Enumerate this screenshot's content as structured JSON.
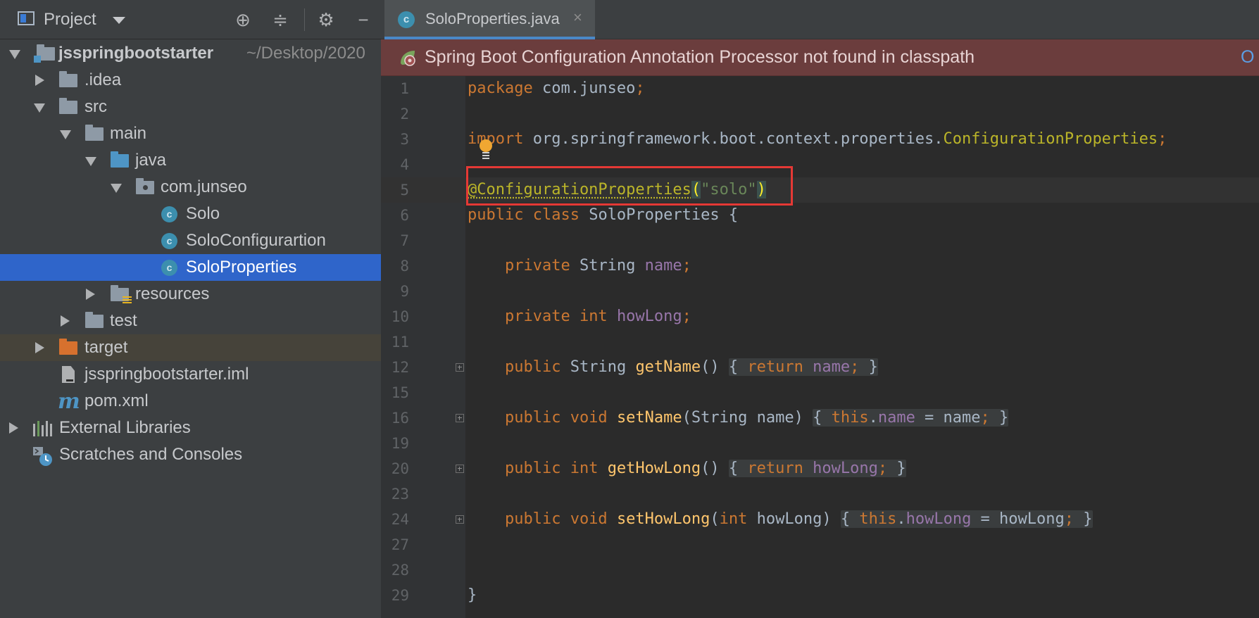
{
  "project_panel": {
    "title": "Project",
    "tree": [
      {
        "label": "jsspringbootstarter",
        "hint": "~/Desktop/2020"
      },
      {
        "label": ".idea"
      },
      {
        "label": "src"
      },
      {
        "label": "main"
      },
      {
        "label": "java"
      },
      {
        "label": "com.junseo"
      },
      {
        "label": "Solo"
      },
      {
        "label": "SoloConfigurartion"
      },
      {
        "label": "SoloProperties"
      },
      {
        "label": "resources"
      },
      {
        "label": "test"
      },
      {
        "label": "target"
      },
      {
        "label": "jsspringbootstarter.iml"
      },
      {
        "label": "pom.xml"
      },
      {
        "label": "External Libraries"
      },
      {
        "label": "Scratches and Consoles"
      }
    ],
    "class_icon_letter": "c",
    "maven_icon_letter": "m"
  },
  "editor": {
    "tab_label": "SoloProperties.java",
    "tab_close": "×",
    "tab_icon_letter": "c",
    "notification": {
      "text": "Spring Boot Configuration Annotation Processor not found in classpath",
      "link": "O"
    },
    "line_numbers": [
      "1",
      "2",
      "3",
      "4",
      "5",
      "6",
      "7",
      "8",
      "9",
      "10",
      "11",
      "12",
      "15",
      "16",
      "19",
      "20",
      "23",
      "24",
      "27",
      "28",
      "29"
    ],
    "code": {
      "l1": {
        "kw": "package",
        "rest": " com.junseo",
        "semi": ";"
      },
      "l3": {
        "kw": "import",
        "rest": " org.springframework.boot.context.properties.",
        "cls": "ConfigurationProperties",
        "semi": ";"
      },
      "l5": {
        "ann": "@ConfigurationProperties",
        "open": "(",
        "str": "\"solo\"",
        "close": ")"
      },
      "l6": {
        "kw": "public class",
        "rest": " SoloProperties {"
      },
      "l8": {
        "indent": "    ",
        "kw": "private",
        "ty": " String ",
        "fld": "name",
        "semi": ";"
      },
      "l10": {
        "indent": "    ",
        "kw": "private int",
        "ty": " ",
        "fld": "howLong",
        "semi": ";"
      },
      "l12": {
        "indent": "    ",
        "kw": "public",
        "ty": " String ",
        "mth": "getName",
        "params": "()",
        "b_open": "{ ",
        "ret": "return",
        "fld": "name",
        "semi": ";",
        "b_close": " }"
      },
      "l16": {
        "indent": "    ",
        "kw": "public void",
        "mth": "setName",
        "params": "(String name)",
        "b_open": "{ ",
        "this": "this",
        "dot": ".",
        "fld": "name",
        "eq": " = name",
        "semi": ";",
        "b_close": " }"
      },
      "l20": {
        "indent": "    ",
        "kw": "public int",
        "mth": "getHowLong",
        "params": "()",
        "b_open": "{ ",
        "ret": "return",
        "fld": "howLong",
        "semi": ";",
        "b_close": " }"
      },
      "l24": {
        "indent": "    ",
        "kw": "public void",
        "mth": "setHowLong",
        "p_open": "(",
        "p_kw": "int",
        "p_rest": " howLong)",
        "b_open": "{ ",
        "this": "this",
        "dot": ".",
        "fld": "howLong",
        "eq": " = howLong",
        "semi": ";",
        "b_close": " }"
      },
      "l29": {
        "rest": "}"
      }
    }
  },
  "colors": {
    "keyword": "#cc7832",
    "field": "#9876aa",
    "method": "#ffc66d",
    "string": "#6a8759",
    "annotation": "#bbb529",
    "selection": "#2f65ca",
    "notification_bg": "#6b3d3d",
    "highlight_box": "#e53935"
  }
}
